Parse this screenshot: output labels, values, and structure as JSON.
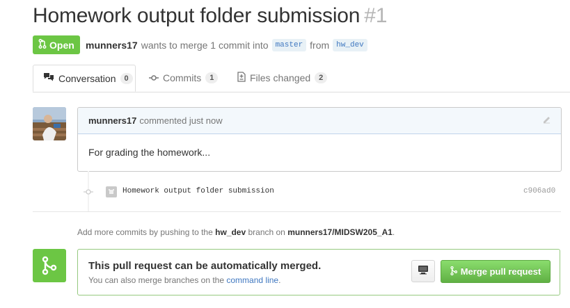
{
  "pr": {
    "title": "Homework output folder submission",
    "number": "#1",
    "state": "Open",
    "author": "munners17",
    "merge_text": "wants to merge 1 commit into",
    "base_branch": "master",
    "from_text": "from",
    "head_branch": "hw_dev"
  },
  "tabs": [
    {
      "label": "Conversation",
      "count": "0",
      "icon": "conversation-icon",
      "selected": true
    },
    {
      "label": "Commits",
      "count": "1",
      "icon": "commit-icon"
    },
    {
      "label": "Files changed",
      "count": "2",
      "icon": "file-diff-icon"
    }
  ],
  "comment": {
    "author": "munners17",
    "action": "commented just now",
    "body": "For grading the homework..."
  },
  "commit": {
    "message": "Homework output folder submission",
    "sha": "c906ad0"
  },
  "help": {
    "prefix": "Add more commits by pushing to the",
    "branch": "hw_dev",
    "middle": "branch on",
    "repo": "munners17/MIDSW205_A1",
    "suffix": "."
  },
  "merge": {
    "title": "This pull request can be automatically merged.",
    "subtitle_prefix": "You can also merge branches on the",
    "subtitle_link": "command line",
    "subtitle_suffix": ".",
    "button_label": "Merge pull request"
  },
  "colors": {
    "open_green": "#6cc644",
    "link_blue": "#4078c0"
  }
}
